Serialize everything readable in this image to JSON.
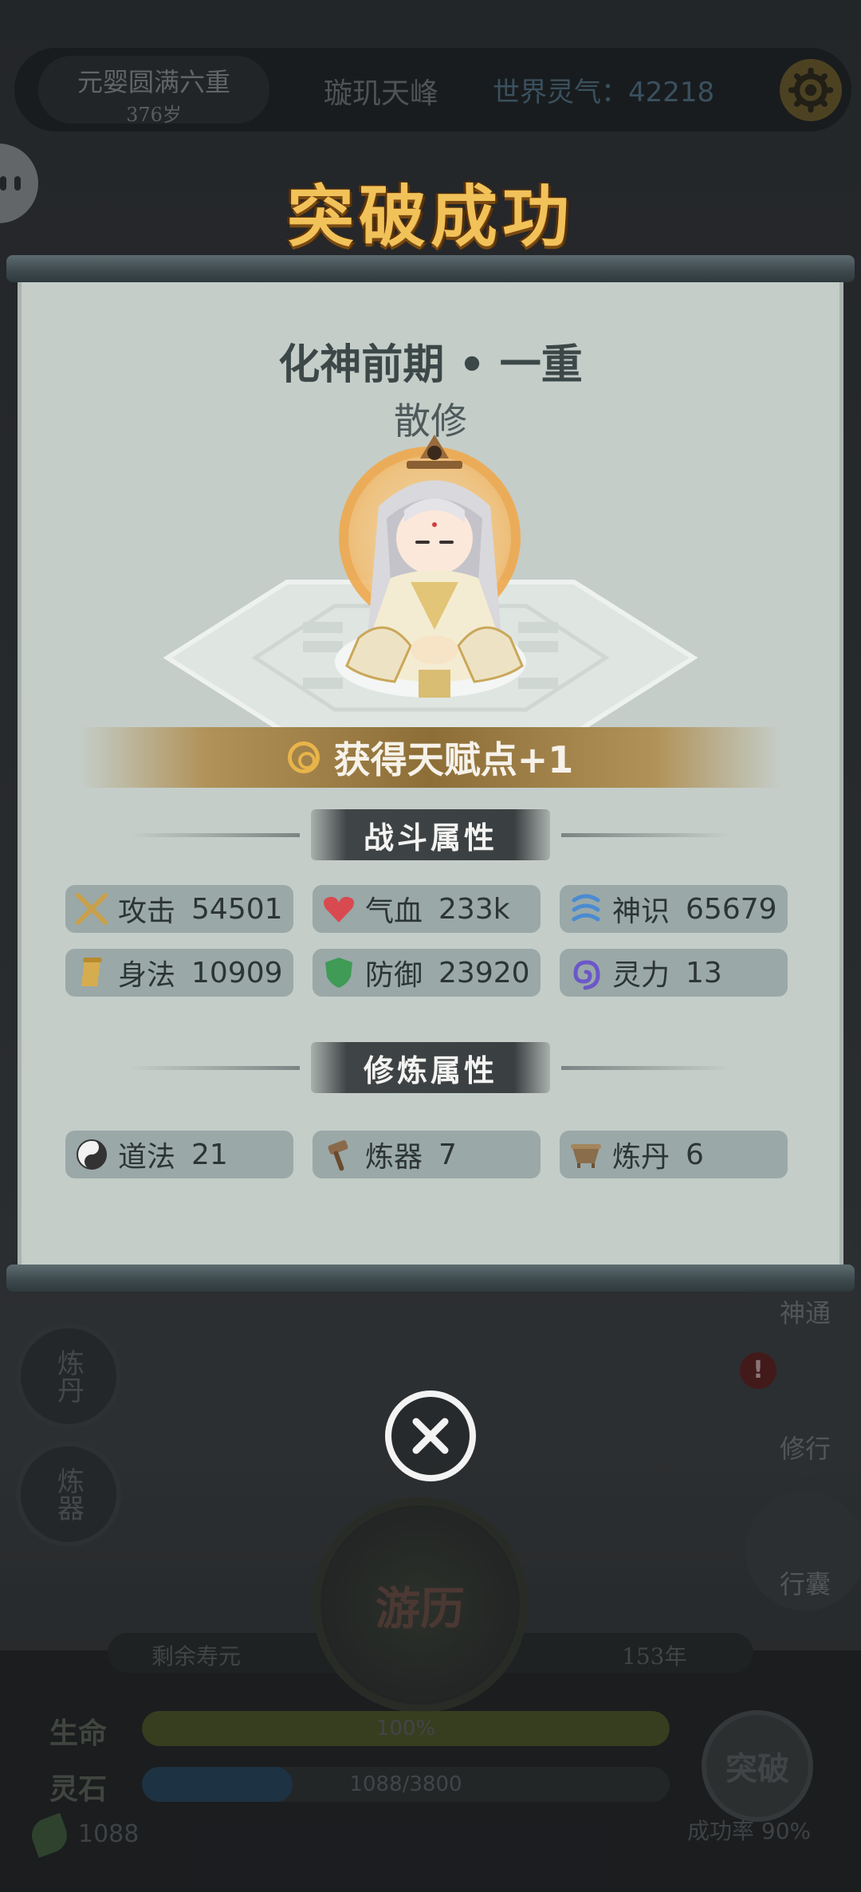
{
  "hud": {
    "realm": "元婴圆满六重",
    "age": "376岁",
    "location": "璇玑天峰",
    "world_qi": "世界灵气：42218"
  },
  "side_buttons": {
    "alchemy": "炼丹",
    "forging": "炼器"
  },
  "right_buttons": {
    "divine": "神通",
    "cultivate": "修行",
    "bag": "行囊"
  },
  "alert": "!",
  "bottom": {
    "lifespan_label": "剩余寿元",
    "lifespan_value": "153年",
    "travel": "游历",
    "hp_label": "生命",
    "hp_text": "100%",
    "hp_ratio": 1.0,
    "stone_label": "灵石",
    "stone_text": "1088/3800",
    "stone_ratio": 0.286,
    "stone_count": "1088",
    "breakthrough": "突破",
    "success_rate": "成功率 90%"
  },
  "modal": {
    "title": "突破成功",
    "realm": "化神前期 • 一重",
    "sect": "散修",
    "talent": "获得天赋点+1",
    "combat_header": "战斗属性",
    "cultivation_header": "修炼属性",
    "combat_stats": [
      {
        "icon": "crossed-swords-icon",
        "name": "攻击",
        "value": "54501"
      },
      {
        "icon": "heart-icon",
        "name": "气血",
        "value": "233k"
      },
      {
        "icon": "spirit-swirl-icon",
        "name": "神识",
        "value": "65679"
      },
      {
        "icon": "scroll-icon",
        "name": "身法",
        "value": "10909"
      },
      {
        "icon": "shield-icon",
        "name": "防御",
        "value": "23920"
      },
      {
        "icon": "spiral-icon",
        "name": "灵力",
        "value": "13"
      }
    ],
    "cultivation_stats": [
      {
        "icon": "yin-yang-icon",
        "name": "道法",
        "value": "21"
      },
      {
        "icon": "hammer-icon",
        "name": "炼器",
        "value": "7"
      },
      {
        "icon": "cauldron-icon",
        "name": "炼丹",
        "value": "6"
      }
    ]
  },
  "colors": {
    "title_gold": "#f2c25a",
    "paper": "#c4cdc8",
    "stat_card": "#9aa8a8",
    "banner_gold": "#8d6e37"
  }
}
